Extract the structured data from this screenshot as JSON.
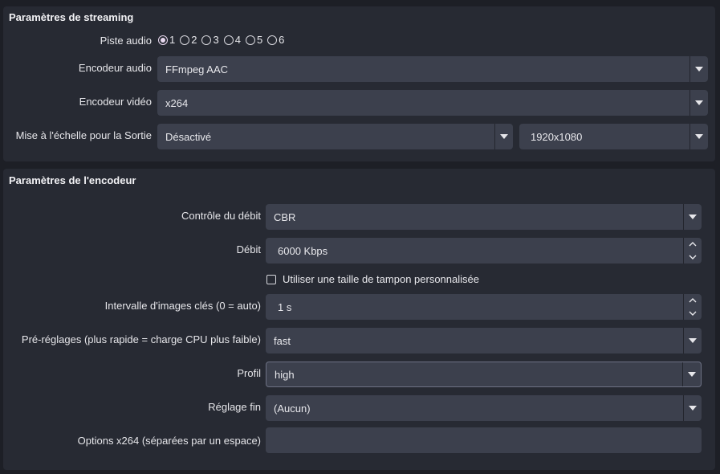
{
  "streaming": {
    "title": "Paramètres de streaming",
    "audio_track_label": "Piste audio",
    "audio_tracks": [
      "1",
      "2",
      "3",
      "4",
      "5",
      "6"
    ],
    "audio_track_selected": "1",
    "audio_encoder_label": "Encodeur audio",
    "audio_encoder_value": "FFmpeg AAC",
    "video_encoder_label": "Encodeur vidéo",
    "video_encoder_value": "x264",
    "rescale_label": "Mise à l'échelle pour la Sortie",
    "rescale_value": "Désactivé",
    "resolution_value": "1920x1080"
  },
  "encoder": {
    "title": "Paramètres de l'encodeur",
    "rate_control_label": "Contrôle du débit",
    "rate_control_value": "CBR",
    "bitrate_label": "Débit",
    "bitrate_value": "6000 Kbps",
    "custom_buffer_label": "Utiliser une taille de tampon personnalisée",
    "custom_buffer_checked": false,
    "keyframe_label": "Intervalle d'images clés (0 = auto)",
    "keyframe_value": "1 s",
    "preset_label": "Pré-réglages (plus rapide = charge CPU plus faible)",
    "preset_value": "fast",
    "profile_label": "Profil",
    "profile_value": "high",
    "tune_label": "Réglage fin",
    "tune_value": "(Aucun)",
    "options_label": "Options x264 (séparées par un espace)",
    "options_value": ""
  }
}
